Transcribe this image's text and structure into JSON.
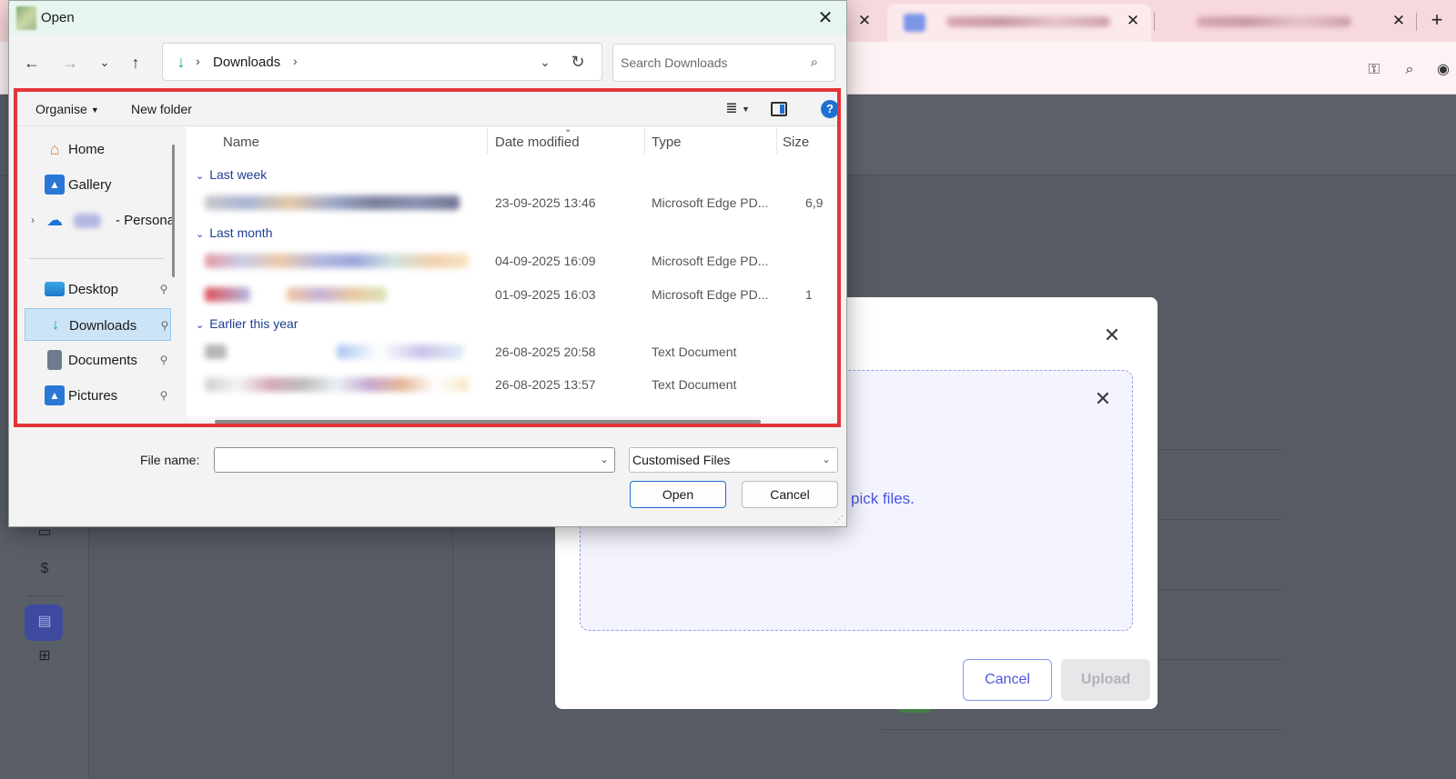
{
  "dialog": {
    "title": "Open",
    "path": {
      "current": "Downloads"
    },
    "search": {
      "placeholder": "Search Downloads"
    },
    "commands": {
      "organise": "Organise",
      "new_folder": "New folder"
    },
    "nav_pane": [
      {
        "label": "Home",
        "icon": "home-icon",
        "pinned": false
      },
      {
        "label": "Gallery",
        "icon": "gallery-icon",
        "pinned": false
      },
      {
        "label": "- Personal",
        "icon": "onedrive-icon",
        "pinned": false,
        "expandable": true
      },
      {
        "label": "Desktop",
        "icon": "desktop-icon",
        "pinned": true
      },
      {
        "label": "Downloads",
        "icon": "downloads-icon",
        "pinned": true,
        "selected": true
      },
      {
        "label": "Documents",
        "icon": "documents-icon",
        "pinned": true
      },
      {
        "label": "Pictures",
        "icon": "pictures-icon",
        "pinned": true
      }
    ],
    "columns": {
      "name": "Name",
      "date": "Date modified",
      "type": "Type",
      "size": "Size"
    },
    "groups": [
      {
        "label": "Last week",
        "files": [
          {
            "date": "23-09-2025 13:46",
            "type": "Microsoft Edge PD...",
            "size": "6,9"
          }
        ]
      },
      {
        "label": "Last month",
        "files": [
          {
            "date": "04-09-2025 16:09",
            "type": "Microsoft Edge PD...",
            "size": ""
          },
          {
            "date": "01-09-2025 16:03",
            "type": "Microsoft Edge PD...",
            "size": "1"
          }
        ]
      },
      {
        "label": "Earlier this year",
        "files": [
          {
            "date": "26-08-2025 20:58",
            "type": "Text Document",
            "size": ""
          },
          {
            "date": "26-08-2025 13:57",
            "type": "Text Document",
            "size": ""
          }
        ]
      }
    ],
    "file_name": {
      "label": "File name:",
      "value": ""
    },
    "filter": {
      "selected": "Customised Files"
    },
    "buttons": {
      "open": "Open",
      "cancel": "Cancel"
    }
  },
  "upload_modal": {
    "hint_text": "pick files.",
    "buttons": {
      "cancel": "Cancel",
      "upload": "Upload"
    }
  },
  "browser": {
    "new_tab": "+"
  },
  "colors": {
    "highlight": "#e3343a",
    "accent": "#4a56e0",
    "selected_nav": "#cce4f7"
  }
}
